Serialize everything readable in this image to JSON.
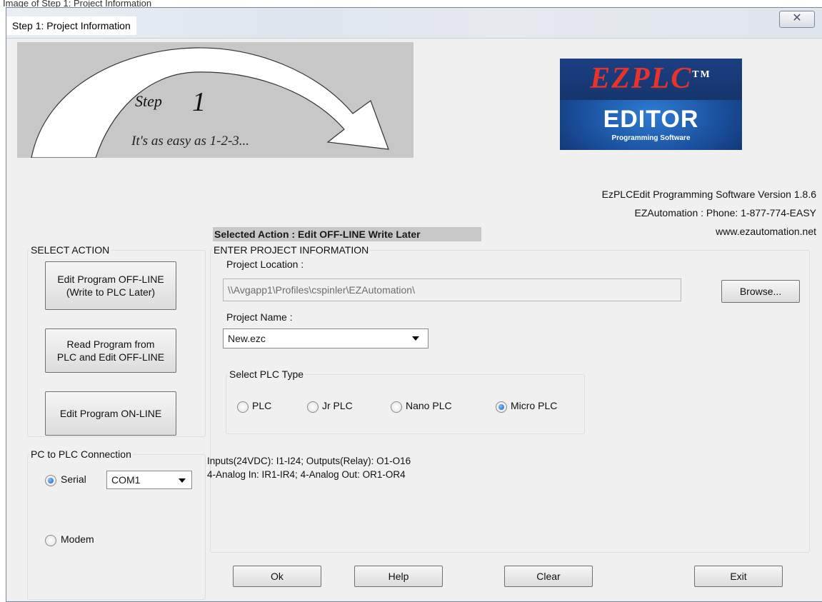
{
  "caption": "Image of Step 1: Project Information",
  "window": {
    "title": "Step 1: Project Information",
    "close_glyph": "✕"
  },
  "banner": {
    "step_word": "Step",
    "step_number": "1",
    "tagline": "It's as easy as 1-2-3..."
  },
  "logo": {
    "brand": "EZPLC",
    "trademark": "TM",
    "product": "EDITOR",
    "sub": "Programming Software"
  },
  "info": {
    "version": "EzPLCEdit Programming Software Version 1.8.6",
    "phone": "EZAutomation : Phone: 1-877-774-EASY",
    "website": "www.ezautomation.net"
  },
  "selected_action": "Selected  Action : Edit OFF-LINE Write Later",
  "select_action": {
    "legend": "SELECT ACTION",
    "buttons": [
      {
        "label": "Edit Program OFF-LINE\n(Write to PLC Later)"
      },
      {
        "label": "Read Program from\nPLC and Edit OFF-LINE"
      },
      {
        "label": "Edit Program ON-LINE"
      }
    ]
  },
  "connection": {
    "legend": "PC to PLC Connection",
    "serial_label": "Serial",
    "serial_selected": true,
    "port_value": "COM1",
    "modem_label": "Modem",
    "modem_selected": false
  },
  "project": {
    "legend": "ENTER PROJECT INFORMATION",
    "location_label": "Project Location :",
    "location_value": "\\\\Avgapp1\\Profiles\\cspinler\\EZAutomation\\",
    "browse_label": "Browse...",
    "name_label": "Project Name :",
    "name_value": "New.ezc",
    "plc_type_legend": "Select PLC Type",
    "plc_types": [
      {
        "label": "PLC",
        "selected": false
      },
      {
        "label": "Jr PLC",
        "selected": false
      },
      {
        "label": "Nano PLC",
        "selected": false
      },
      {
        "label": "Micro PLC",
        "selected": true
      }
    ],
    "io_line1": "Inputs(24VDC): I1-I24; Outputs(Relay): O1-O16",
    "io_line2": "4-Analog In: IR1-IR4; 4-Analog Out: OR1-OR4"
  },
  "footer": {
    "ok": "Ok",
    "help": "Help",
    "clear": "Clear",
    "exit": "Exit"
  }
}
